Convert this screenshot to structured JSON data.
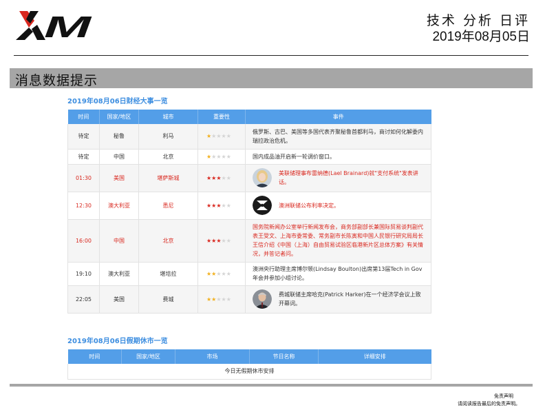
{
  "header": {
    "logo_text": "XM",
    "title": "技术 分析 日评",
    "date": "2019年08月05日"
  },
  "section": {
    "title": "消息数据提示"
  },
  "events": {
    "title": "2019年08月06日财经大事一览",
    "columns": [
      "时间",
      "国家/地区",
      "城市",
      "重要性",
      "事件"
    ],
    "rows": [
      {
        "time": "待定",
        "region": "秘鲁",
        "city": "利马",
        "stars": 1,
        "highlight": false,
        "avatar": "",
        "event": "俄罗斯、古巴、美国等多国代表齐聚秘鲁首都利马，商讨如何化解委内瑞拉政治危机。"
      },
      {
        "time": "待定",
        "region": "中国",
        "city": "北京",
        "stars": 1,
        "highlight": false,
        "avatar": "",
        "event": "国内成品油开启新一轮调价窗口。"
      },
      {
        "time": "01:30",
        "region": "美国",
        "city": "堪萨斯城",
        "stars": 3,
        "highlight": true,
        "avatar": "woman-portrait",
        "event": "美联储理事布雷纳德(Lael Brainard)就\"支付系统\"发表讲话。"
      },
      {
        "time": "12:30",
        "region": "澳大利亚",
        "city": "悉尼",
        "stars": 3,
        "highlight": true,
        "avatar": "rba-logo",
        "event": "澳洲联储公布利率决定。"
      },
      {
        "time": "16:00",
        "region": "中国",
        "city": "北京",
        "stars": 3,
        "highlight": true,
        "avatar": "",
        "event": "国务院新闻办公室举行新闻发布会，商务部副部长兼国际贸易谈判副代表王受文、上海市委常委、常务副市长陈寅和中国人民银行研究局局长王信介绍《中国（上海）自由贸易试验区临港新片区总体方案》有关情况，并答记者问。"
      },
      {
        "time": "19:10",
        "region": "澳大利亚",
        "city": "堪培拉",
        "stars": 2,
        "highlight": false,
        "avatar": "",
        "event": "澳洲央行助理主席博尔顿(Lindsay Boulton)出席第13届Tech in Gov年会并参加小组讨论。"
      },
      {
        "time": "22:05",
        "region": "美国",
        "city": "费城",
        "stars": 2,
        "highlight": false,
        "avatar": "man-portrait",
        "event": "费城联储主席哈克(Patrick Harker)在一个经济学会议上致开幕词。"
      }
    ]
  },
  "holidays": {
    "title": "2019年08月06日假期休市一览",
    "columns": [
      "时间",
      "国家/地区",
      "市场",
      "节日名称",
      "详细安排"
    ],
    "empty_text": "今日无假期休市安排"
  },
  "footer": {
    "disclaimer": "免责声明",
    "disclaimer_note": "请阅读报告最后的免责声明。"
  },
  "colors": {
    "table_header": "#539ee8",
    "title_blue": "#3d8ee0",
    "highlight_red": "#d9281f",
    "star_yellow": "#f2b01e",
    "section_grey": "#a6a6a6"
  }
}
